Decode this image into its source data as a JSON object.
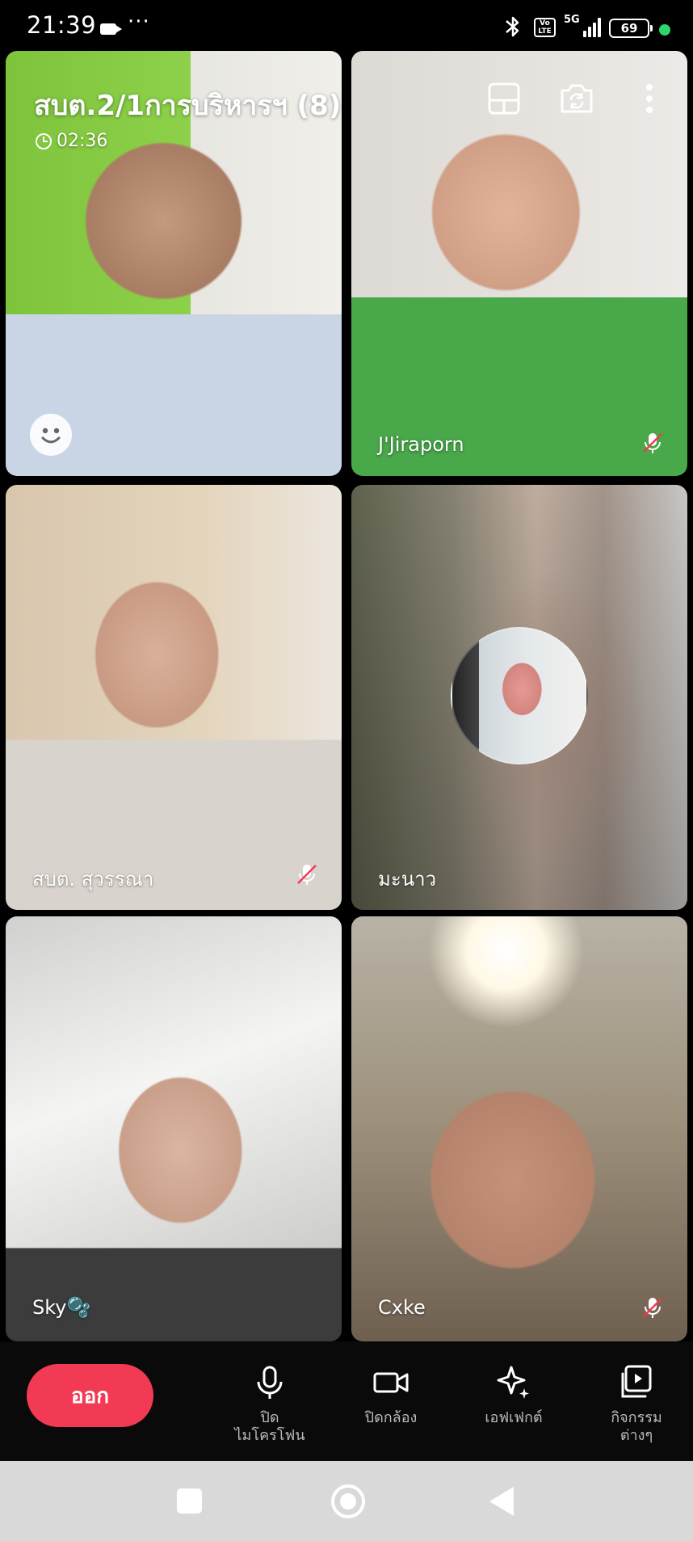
{
  "status_bar": {
    "time": "21:39",
    "dots": "···",
    "network": "5G",
    "volte": "Vo LTE",
    "battery": "69"
  },
  "call": {
    "title": "สบต.2/1การบริหารฯ (8)",
    "duration": "02:36"
  },
  "participants": [
    {
      "name": "",
      "muted": false
    },
    {
      "name": "J'Jiraporn",
      "muted": true
    },
    {
      "name": "สบต. สุวรรณา",
      "muted": true
    },
    {
      "name": "มะนาว",
      "muted": false
    },
    {
      "name": "Sky🫧",
      "muted": false
    },
    {
      "name": "Cxke",
      "muted": true
    }
  ],
  "toolbar": {
    "leave_label": "ออก",
    "mic_label": "ปิด\nไมโครโฟน",
    "camera_label": "ปิดกล้อง",
    "effects_label": "เอฟเฟกต์",
    "activities_label": "กิจกรรม\nต่างๆ"
  },
  "colors": {
    "leave_button": "#f23a55",
    "status_dot": "#2fd66a",
    "toolbar_bg": "#0a0a0a",
    "nav_bg": "#d9d9d9"
  },
  "icons": [
    "layout-icon",
    "switch-camera-icon",
    "more-options-icon",
    "emoji-icon",
    "mic-off-icon",
    "microphone-icon",
    "video-camera-icon",
    "sparkle-icon",
    "activities-icon"
  ]
}
